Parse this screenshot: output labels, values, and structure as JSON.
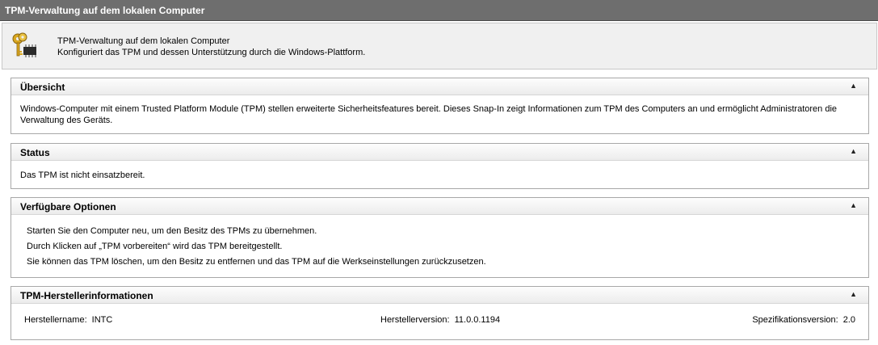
{
  "window": {
    "title": "TPM-Verwaltung auf dem lokalen Computer"
  },
  "header": {
    "title": "TPM-Verwaltung auf dem lokalen Computer",
    "subtitle": "Konfiguriert das TPM und dessen Unterstützung durch die Windows-Plattform.",
    "icon": "keys-chip-icon"
  },
  "sections": {
    "overview": {
      "title": "Übersicht",
      "collapse_glyph": "▲",
      "text": "Windows-Computer mit einem Trusted Platform Module (TPM) stellen erweiterte Sicherheitsfeatures bereit. Dieses Snap-In zeigt Informationen zum TPM des Computers an und ermöglicht Administratoren die Verwaltung des Geräts."
    },
    "status": {
      "title": "Status",
      "collapse_glyph": "▲",
      "text": "Das TPM ist nicht einsatzbereit."
    },
    "options": {
      "title": "Verfügbare Optionen",
      "collapse_glyph": "▲",
      "items": [
        "Starten Sie den Computer neu, um den Besitz des TPMs zu übernehmen.",
        "Durch Klicken auf „TPM vorbereiten“ wird das TPM bereitgestellt.",
        "Sie können das TPM löschen, um den Besitz zu entfernen und das TPM auf die Werkseinstellungen zurückzusetzen."
      ]
    },
    "vendor": {
      "title": "TPM-Herstellerinformationen",
      "collapse_glyph": "▲",
      "name_label": "Herstellername:",
      "name_value": "INTC",
      "version_label": "Herstellerversion:",
      "version_value": "11.0.0.1194",
      "spec_label": "Spezifikationsversion:",
      "spec_value": "2.0"
    }
  }
}
